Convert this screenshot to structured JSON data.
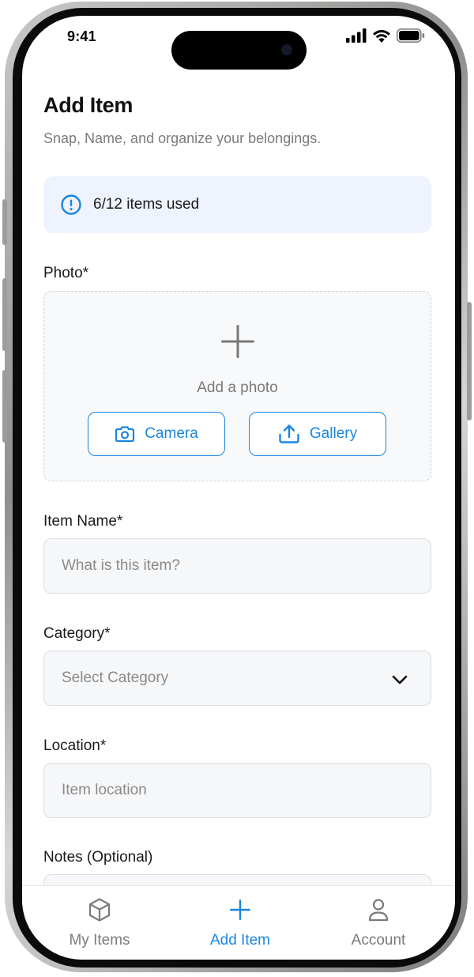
{
  "status_bar": {
    "time": "9:41"
  },
  "header": {
    "title": "Add Item",
    "subtitle": "Snap, Name, and organize your belongings."
  },
  "usage_banner": {
    "text": "6/12 items used",
    "icon": "info-icon"
  },
  "photo": {
    "label": "Photo*",
    "add_text": "Add a photo",
    "camera_label": "Camera",
    "gallery_label": "Gallery"
  },
  "item_name": {
    "label": "Item Name*",
    "placeholder": "What is this item?",
    "value": ""
  },
  "category": {
    "label": "Category*",
    "placeholder": "Select Category",
    "value": ""
  },
  "location": {
    "label": "Location*",
    "placeholder": "Item location",
    "value": ""
  },
  "notes": {
    "label": "Notes (Optional)"
  },
  "tabs": [
    {
      "label": "My Items",
      "icon": "cube-icon",
      "active": false
    },
    {
      "label": "Add Item",
      "icon": "plus-icon",
      "active": true
    },
    {
      "label": "Account",
      "icon": "user-icon",
      "active": false
    }
  ],
  "colors": {
    "accent": "#1a86e0",
    "banner_bg": "#eef3fd",
    "muted_text": "#7b7b7b",
    "inactive_tab": "#7a7a7a"
  }
}
